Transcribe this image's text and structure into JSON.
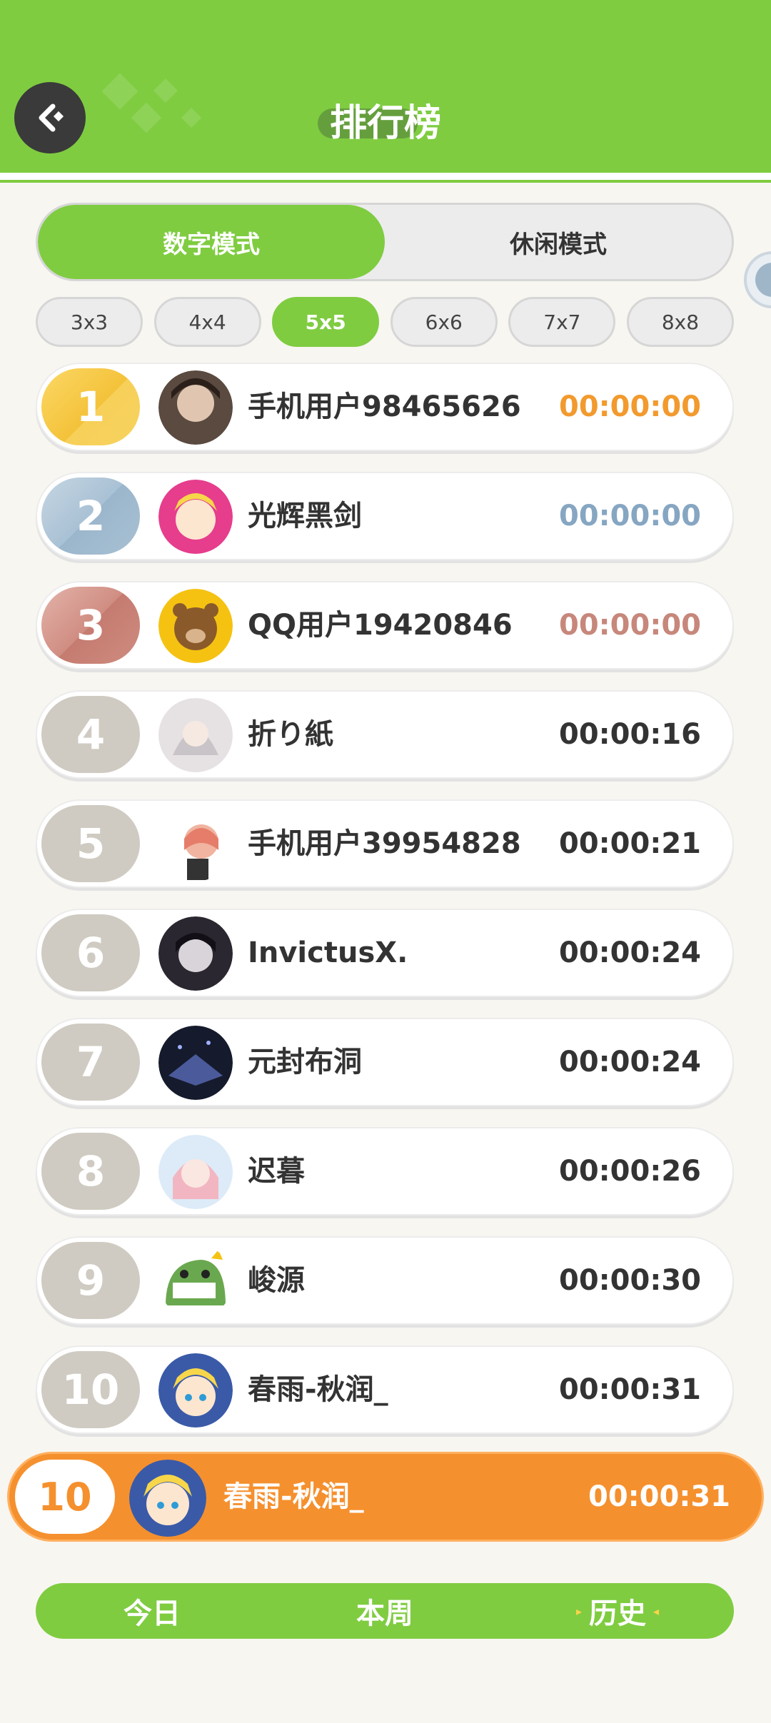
{
  "header": {
    "title": "排行榜"
  },
  "colors": {
    "accent": "#7fcc41",
    "orange": "#f5902e",
    "gold": "#f29a2e",
    "silver": "#86a6c2",
    "bronze": "#c7877b"
  },
  "mode_tabs": [
    {
      "label": "数字模式",
      "active": true
    },
    {
      "label": "休闲模式",
      "active": false
    }
  ],
  "size_chips": [
    {
      "label": "3x3",
      "active": false
    },
    {
      "label": "4x4",
      "active": false
    },
    {
      "label": "5x5",
      "active": true
    },
    {
      "label": "6x6",
      "active": false
    },
    {
      "label": "7x7",
      "active": false
    },
    {
      "label": "8x8",
      "active": false
    }
  ],
  "ranks": [
    {
      "rank": "1",
      "name": "手机用户98465626",
      "time": "00:00:00",
      "tier": "gold",
      "avatar_color": "#5a4a40"
    },
    {
      "rank": "2",
      "name": "光辉黑剑",
      "time": "00:00:00",
      "tier": "silver",
      "avatar_color": "#e63d8d"
    },
    {
      "rank": "3",
      "name": "QQ用户19420846",
      "time": "00:00:00",
      "tier": "bronze",
      "avatar_color": "#f5c211"
    },
    {
      "rank": "4",
      "name": "折り紙",
      "time": "00:00:16",
      "tier": "normal",
      "avatar_color": "#d9d6d8"
    },
    {
      "rank": "5",
      "name": "手机用户39954828",
      "time": "00:00:21",
      "tier": "normal",
      "avatar_color": "#e8a090"
    },
    {
      "rank": "6",
      "name": "InvictusX.",
      "time": "00:00:24",
      "tier": "normal",
      "avatar_color": "#2b2730"
    },
    {
      "rank": "7",
      "name": "元封布洞",
      "time": "00:00:24",
      "tier": "normal",
      "avatar_color": "#1e2840"
    },
    {
      "rank": "8",
      "name": "迟暮",
      "time": "00:00:26",
      "tier": "normal",
      "avatar_color": "#f4c6d0"
    },
    {
      "rank": "9",
      "name": "峻源",
      "time": "00:00:30",
      "tier": "normal",
      "avatar_color": "#6aa84f"
    },
    {
      "rank": "10",
      "name": "春雨-秋润_",
      "time": "00:00:31",
      "tier": "normal",
      "avatar_color": "#3a5aa8"
    }
  ],
  "my_rank": {
    "rank": "10",
    "name": "春雨-秋润_",
    "time": "00:00:31",
    "avatar_color": "#3a5aa8"
  },
  "period_tabs": [
    {
      "label": "今日",
      "active": false
    },
    {
      "label": "本周",
      "active": false
    },
    {
      "label": "历史",
      "active": true
    }
  ],
  "icons": {
    "back": "back-arrow-icon"
  }
}
